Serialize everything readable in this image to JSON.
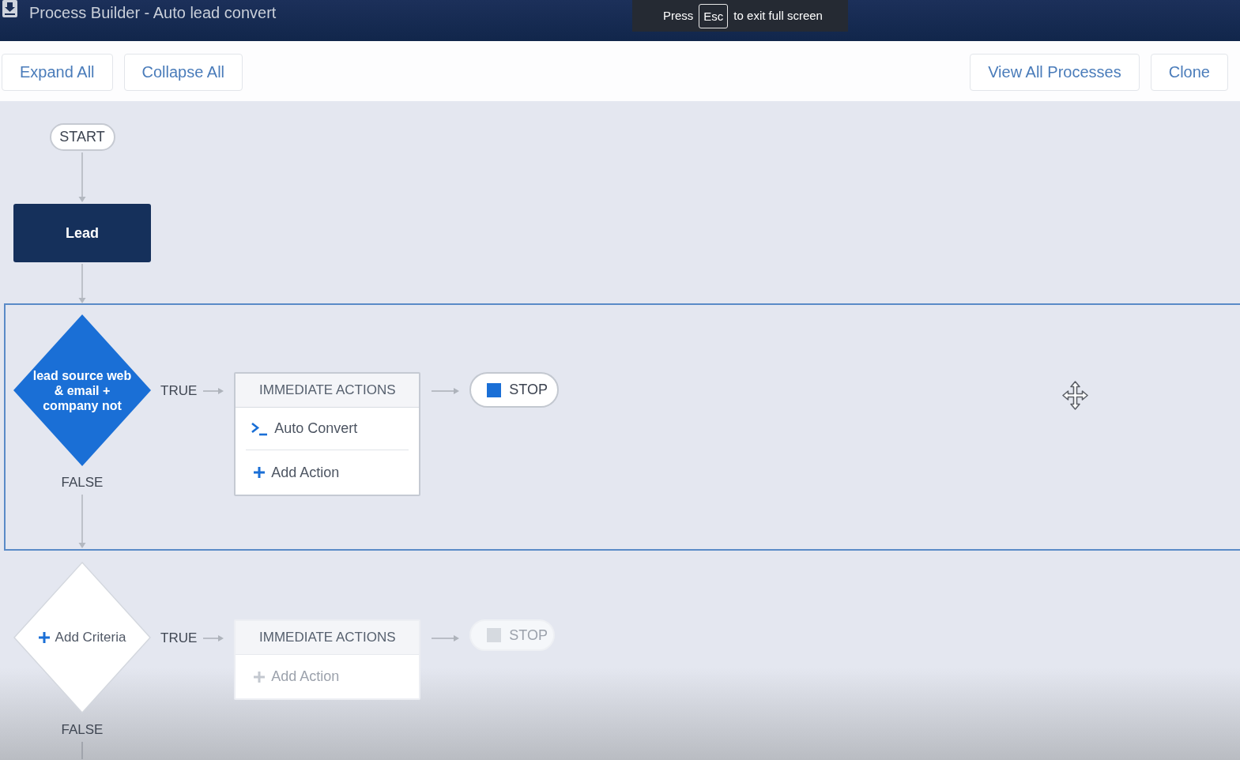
{
  "window": {
    "title": "Process Builder - Auto lead convert"
  },
  "fullscreen_notice": {
    "before_key": "Press",
    "key": "Esc",
    "after_key": "to exit full screen"
  },
  "toolbar": {
    "left_buttons": [
      {
        "label": "Expand All"
      },
      {
        "label": "Collapse All"
      }
    ],
    "right_buttons": [
      {
        "label": "View All Processes"
      },
      {
        "label": "Clone"
      }
    ]
  },
  "canvas": {
    "start": {
      "label": "START"
    },
    "object": {
      "label": "Lead"
    },
    "criteria": [
      {
        "kind": "defined",
        "label": "lead source web & email + company not",
        "selected": true,
        "true_label": "TRUE",
        "false_label": "FALSE",
        "actions": {
          "header": "IMMEDIATE ACTIONS",
          "items": [
            {
              "kind": "apex",
              "label": "Auto Convert"
            }
          ],
          "add_action": {
            "label": "Add Action",
            "disabled": false
          }
        },
        "stop": {
          "label": "STOP",
          "disabled": false
        }
      },
      {
        "kind": "empty",
        "label": "Add Criteria",
        "selected": false,
        "true_label": "TRUE",
        "false_label": "FALSE",
        "actions": {
          "header": "IMMEDIATE ACTIONS",
          "add_action": {
            "label": "Add Action",
            "disabled": true
          }
        },
        "stop": {
          "label": "STOP",
          "disabled": true
        }
      }
    ]
  }
}
